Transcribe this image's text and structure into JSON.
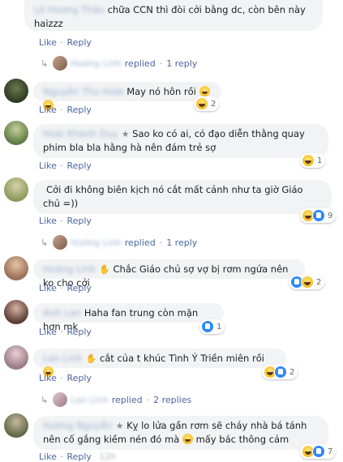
{
  "actions": {
    "like": "Like",
    "sep": "·",
    "reply": "Reply"
  },
  "comments": [
    {
      "id": "c1",
      "author": "Lê Hương Thảo",
      "text": "chữa CCN thì đòi cởi bằng dc, còn bên này haizzz",
      "time": ""
    },
    {
      "id": "c2",
      "author": "Nguyễn Thu Hoài",
      "text": "May nó hôn rồi",
      "reaction_count": "2",
      "time": ""
    },
    {
      "id": "c3",
      "author": "Hoài Khánh Duy",
      "text": "Sao ko có ai, có đạo diễn thằng quay phim bla bla hằng hà nên đám trẻ sợ",
      "reaction_count": "1",
      "time": ""
    },
    {
      "id": "c4",
      "author": "",
      "text": "Cởi đi không biên kịch nó cắt mất cảnh như ta giờ Giáo chủ =))",
      "reaction_count": "9",
      "time": ""
    },
    {
      "id": "c5",
      "author": "Hoàng Linh",
      "text": "Chắc Giáo chủ sợ vợ bị rơm ngứa nên ko cho cởi",
      "reaction_count": "2",
      "time": ""
    },
    {
      "id": "c6",
      "author": "Anh Lan",
      "text": "Haha fan trung còn mặn hơn mk",
      "reaction_count": "1",
      "time": ""
    },
    {
      "id": "c7",
      "author": "Lan Linh",
      "text": "cắt của t khúc Tình Ý Triền miên rồi",
      "reaction_count": "2",
      "time": ""
    },
    {
      "id": "c8",
      "author": "Hương Nguyễn",
      "text": "Kỵ lo lửa gần rơm sẽ cháy nhà bá tánh nên cố gắng kiềm nén đó mà",
      "text2": "mấy bác thông cảm",
      "reaction_count": "7",
      "time": "12h"
    }
  ],
  "reply_threads": [
    {
      "id": "r1",
      "author": "Hương Linh",
      "label": "replied",
      "sep": "·",
      "count": "1 reply"
    },
    {
      "id": "r2",
      "author": "Hương Linh",
      "label": "replied",
      "sep": "·",
      "count": "1 reply"
    },
    {
      "id": "r3",
      "author": "Lan Linh",
      "label": "replied",
      "sep": "·",
      "count": "2 replies"
    }
  ]
}
